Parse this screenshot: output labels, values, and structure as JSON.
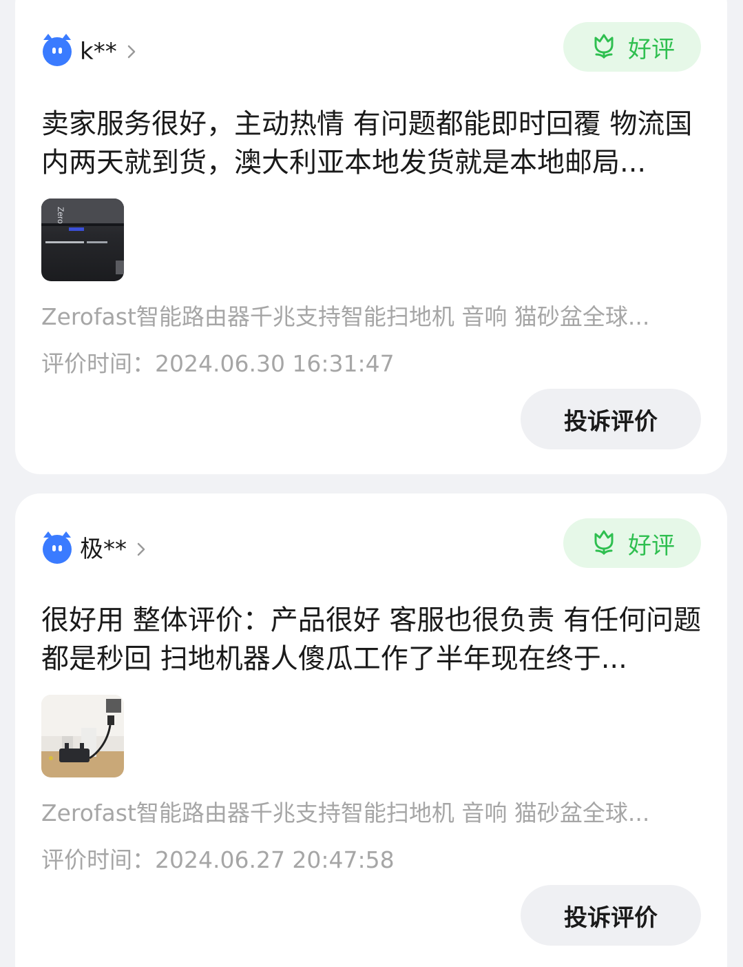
{
  "reviews": [
    {
      "username": "k**",
      "badge_label": "好评",
      "text": "卖家服务很好，主动热情 有问题都能即时回覆 物流国内两天就到货，澳大利亚本地发货就是本地邮局...",
      "thumb_text": "Zero",
      "product": "Zerofast智能路由器千兆支持智能扫地机 音响 猫砂盆全球...",
      "time_label": "评价时间：",
      "time_value": "2024.06.30 16:31:47",
      "complain_label": "投诉评价"
    },
    {
      "username": "极**",
      "badge_label": "好评",
      "text": "很好用 整体评价：产品很好 客服也很负责 有任何问题都是秒回 扫地机器人傻瓜工作了半年现在终于...",
      "product": "Zerofast智能路由器千兆支持智能扫地机 音响 猫砂盆全球...",
      "time_label": "评价时间：",
      "time_value": "2024.06.27 20:47:58",
      "complain_label": "投诉评价"
    }
  ],
  "colors": {
    "accent_blue": "#3a7bff",
    "badge_green": "#2fbf50",
    "badge_bg": "#e6f8e8",
    "muted_text": "#a6a6a6",
    "page_bg": "#f1f2f5"
  },
  "icons": {
    "avatar": "blue-cat-avatar-icon",
    "chevron": "chevron-right-icon",
    "badge": "tulip-icon"
  }
}
